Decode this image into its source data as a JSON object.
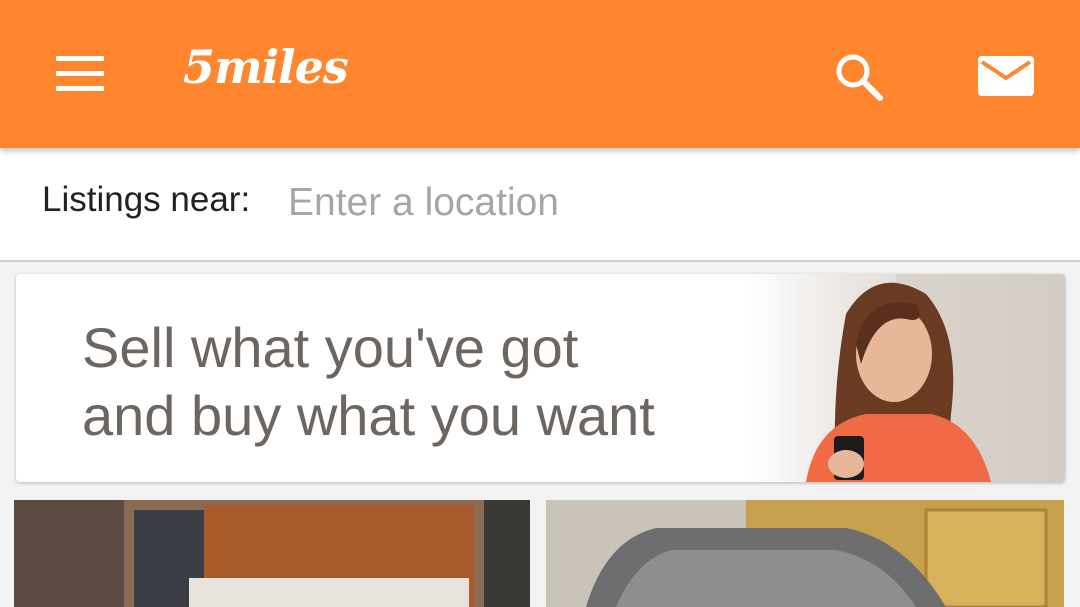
{
  "app": {
    "logo_text": "5miles",
    "accent_color": "#ff862f"
  },
  "header": {
    "menu_icon": "hamburger-menu-icon",
    "search_icon": "search-icon",
    "mail_icon": "mail-icon"
  },
  "location": {
    "label": "Listings near:",
    "placeholder": "Enter a location",
    "value": ""
  },
  "banner": {
    "line1": "Sell what you've got",
    "line2": "and buy what you want"
  },
  "listings": [
    {
      "image": "furniture-photo"
    },
    {
      "image": "wicker-basket-photo"
    }
  ]
}
